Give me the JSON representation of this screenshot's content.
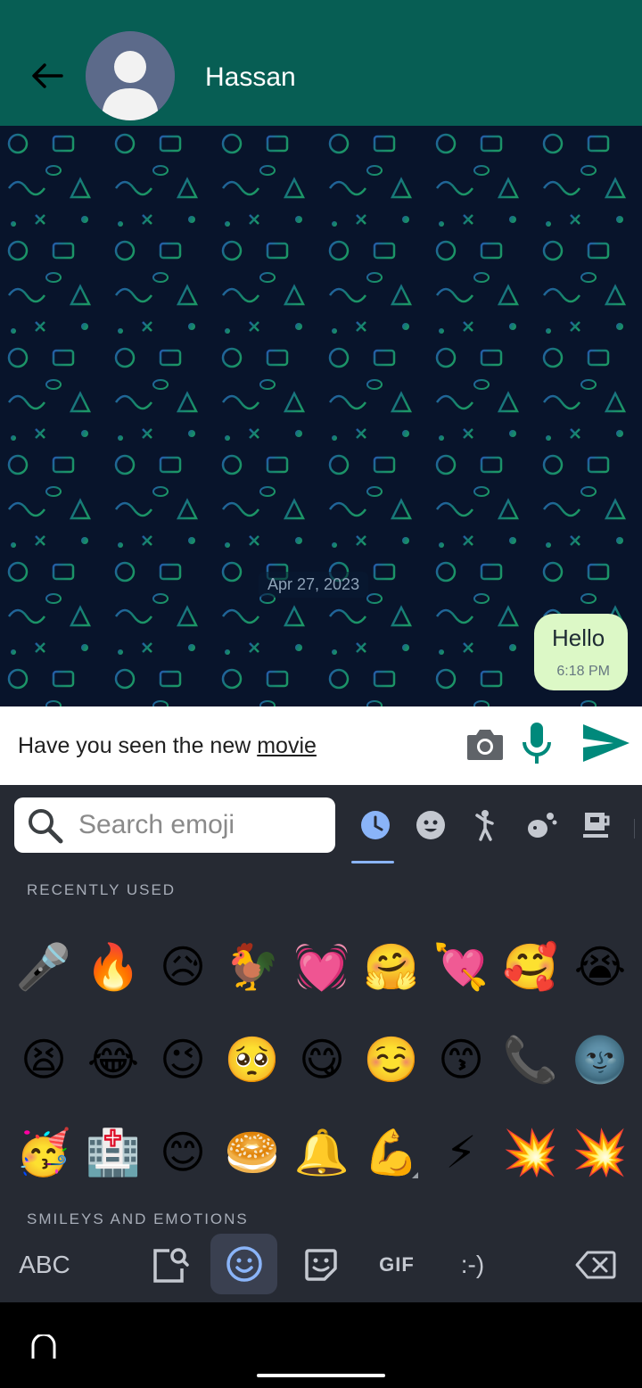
{
  "header": {
    "contact_name": "Hassan"
  },
  "chat": {
    "date_chip": "Apr 27, 2023",
    "messages": [
      {
        "text": "Hello",
        "time": "6:18 PM"
      }
    ]
  },
  "composer": {
    "typed_text": "Have you seen the new ",
    "underlined_word": "movie"
  },
  "emoji_keyboard": {
    "search_placeholder": "Search emoji",
    "recent_label": "RECENTLY USED",
    "next_section_label": "SMILEYS AND EMOTIONS",
    "recent_emojis": [
      "🎤",
      "🔥",
      "😥",
      "🐓",
      "💓",
      "🤗",
      "💘",
      "🥰",
      "😭",
      "😫",
      "😂",
      "😉",
      "🥺",
      "😋",
      "☺️",
      "😙",
      "📞",
      "🌚",
      "🥳",
      "🏥",
      "😊",
      "🥯",
      "🔔",
      "💪",
      "⚡",
      "💥",
      "💥"
    ],
    "bottom_bar": {
      "abc_label": "ABC",
      "gif_label": "GIF",
      "emoticon_label": ":-)"
    }
  },
  "colors": {
    "header_bg": "#075e54",
    "accent": "#00897b",
    "bubble_out": "#dcf8c6",
    "keyboard_bg": "#262a33"
  }
}
